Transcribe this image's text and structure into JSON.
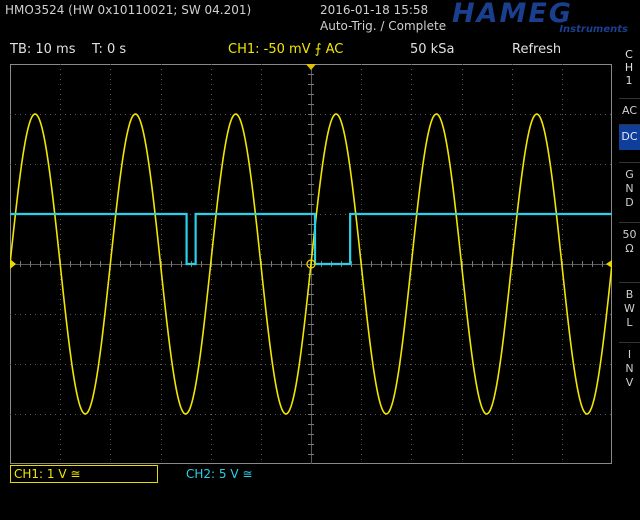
{
  "header": {
    "model": "HMO3524 (HW 0x10110021; SW 04.201)",
    "datetime": "2016-01-18 15:58",
    "trigger_state": "Auto-Trig. / Complete",
    "logo_main": "HAMEG",
    "logo_sub": "Instruments"
  },
  "status": {
    "timebase": "TB: 10 ms",
    "time_offset": "T: 0 s",
    "trigger": "CH1: -50 mV ⨍ AC",
    "sample_rate": "50 kSa",
    "acq_mode": "Refresh"
  },
  "channels": {
    "ch1": "CH1: 1 V ≅",
    "ch2": "CH2: 5 V ≅"
  },
  "sidebar": {
    "title_lines": [
      "C",
      "H",
      "1"
    ],
    "buttons": [
      {
        "lines": [
          "AC"
        ],
        "active": false
      },
      {
        "lines": [
          "DC"
        ],
        "active": true
      },
      {
        "lines": [
          "G",
          "N",
          "D"
        ],
        "active": false
      },
      {
        "lines": [
          "50",
          "Ω"
        ],
        "active": false
      },
      {
        "lines": [
          "B",
          "W",
          "L"
        ],
        "active": false
      },
      {
        "lines": [
          "I",
          "N",
          "V"
        ],
        "active": false
      }
    ]
  },
  "colors": {
    "ch1": "#f2e600",
    "ch2": "#2ad0e8",
    "grid": "#5a5a5a",
    "active_button": "#0f3f9a"
  },
  "waveforms": {
    "ch1": {
      "type": "sine",
      "frequency_hz": 50,
      "amplitude_div": 3,
      "time_offset_ms": 0
    },
    "ch2": {
      "type": "logic",
      "high_div": 1,
      "low_div": 0,
      "low_intervals_ms": [
        [
          -24.8,
          -23.0
        ],
        [
          0.8,
          7.8
        ]
      ]
    }
  }
}
